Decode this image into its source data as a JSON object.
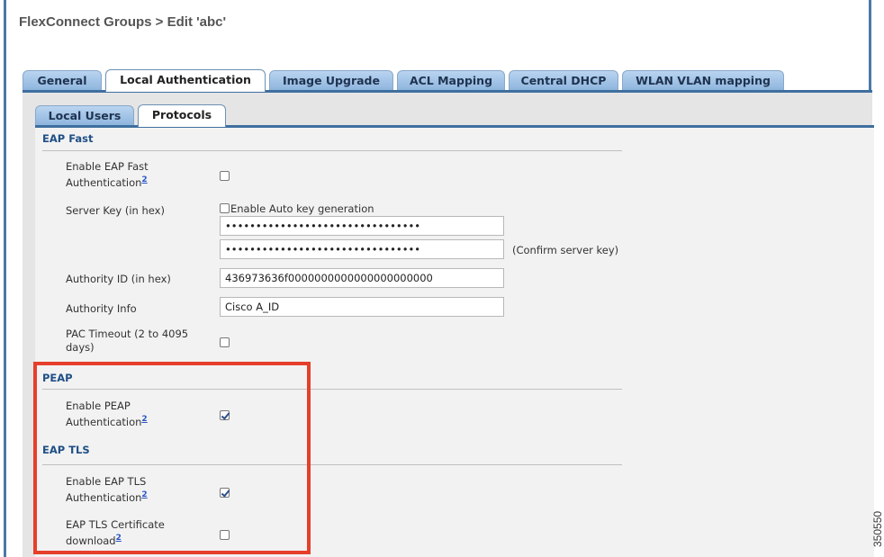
{
  "header": {
    "title": "FlexConnect Groups > Edit   'abc'"
  },
  "tabs": [
    {
      "label": "General"
    },
    {
      "label": "Local Authentication"
    },
    {
      "label": "Image Upgrade"
    },
    {
      "label": "ACL Mapping"
    },
    {
      "label": "Central DHCP"
    },
    {
      "label": "WLAN VLAN mapping"
    }
  ],
  "active_tab": "Local Authentication",
  "subtabs": [
    {
      "label": "Local Users"
    },
    {
      "label": "Protocols"
    }
  ],
  "active_subtab": "Protocols",
  "footnote_marker": "2",
  "eap_fast": {
    "heading": "EAP Fast",
    "enable_label": "Enable EAP Fast Authentication",
    "enable_checked": false,
    "server_key_label": "Server Key (in hex)",
    "auto_key_label": "Enable Auto key generation",
    "auto_key_checked": false,
    "server_key_value": "••••••••••••••••••••••••••••••••",
    "confirm_key_value": "••••••••••••••••••••••••••••••••",
    "confirm_label": "(Confirm server key)",
    "authority_id_label": "Authority ID (in hex)",
    "authority_id_value": "436973636f0000000000000000000000",
    "authority_info_label": "Authority Info",
    "authority_info_value": "Cisco A_ID",
    "pac_timeout_label": "PAC Timeout (2 to 4095 days)",
    "pac_timeout_checked": false
  },
  "peap": {
    "heading": "PEAP",
    "enable_label": "Enable PEAP Authentication",
    "enable_checked": true
  },
  "eap_tls": {
    "heading": "EAP TLS",
    "enable_label": "Enable EAP TLS Authentication",
    "enable_checked": true,
    "cert_label": "EAP TLS Certificate download",
    "cert_checked": false
  },
  "watermark": "350550",
  "colors": {
    "highlight": "#e53f2b",
    "tab_bar": "#3f6f9f",
    "section_heading": "#1f4f86"
  }
}
